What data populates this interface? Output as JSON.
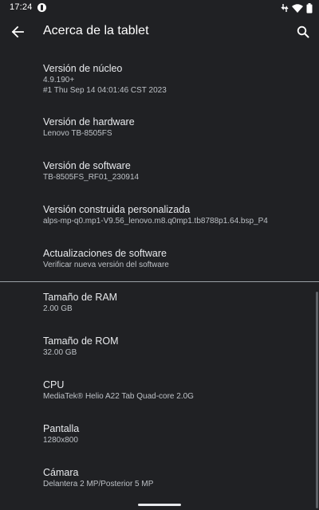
{
  "status_bar": {
    "time": "17:24"
  },
  "app_bar": {
    "title": "Acerca de la tablet"
  },
  "items": [
    {
      "title": "Versión de núcleo",
      "summary": [
        "4.9.190+",
        "#1 Thu Sep 14 04:01:46 CST 2023"
      ]
    },
    {
      "title": "Versión de hardware",
      "summary": [
        "Lenovo TB-8505FS"
      ]
    },
    {
      "title": "Versión de software",
      "summary": [
        "TB-8505FS_RF01_230914"
      ]
    },
    {
      "title": "Versión construida personalizada",
      "summary": [
        "alps-mp-q0.mp1-V9.56_lenovo.m8.q0mp1.tb8788p1.64.bsp_P4"
      ]
    },
    {
      "title": "Actualizaciones de software",
      "summary": [
        "Verificar nueva versión del software"
      ]
    },
    {
      "title": "Tamaño de RAM",
      "summary": [
        "2.00 GB"
      ]
    },
    {
      "title": "Tamaño de ROM",
      "summary": [
        "32.00 GB"
      ]
    },
    {
      "title": "CPU",
      "summary": [
        "MediaTek® Helio A22 Tab Quad-core 2.0G"
      ]
    },
    {
      "title": "Pantalla",
      "summary": [
        "1280x800"
      ]
    },
    {
      "title": "Cámara",
      "summary": [
        "Delantera 2 MP/Posterior 5 MP"
      ]
    }
  ],
  "icons": {
    "back": "arrow-back-icon",
    "search": "search-icon",
    "notification": "notification-icon",
    "signal": "signal-icon",
    "wifi": "wifi-icon",
    "battery": "battery-icon"
  }
}
